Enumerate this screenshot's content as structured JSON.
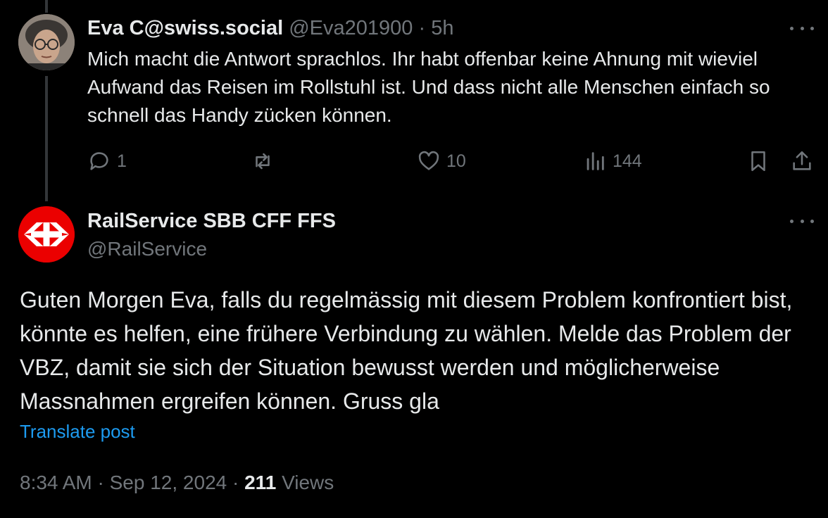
{
  "reply": {
    "author_name": "Eva C@swiss.social",
    "author_handle": "@Eva201900",
    "separator": "·",
    "time_ago": "5h",
    "text": "Mich macht die Antwort sprachlos. Ihr habt offenbar keine Ahnung mit wieviel Aufwand das Reisen im Rollstuhl ist. Und dass nicht alle Menschen einfach so schnell das Handy zücken können.",
    "reply_count": "1",
    "repost_count": "",
    "like_count": "10",
    "view_count": "144"
  },
  "main_post": {
    "author_name": "RailService SBB CFF FFS",
    "author_handle": "@RailService",
    "text": "Guten Morgen Eva, falls du regelmässig mit diesem Problem konfrontiert bist, könnte es helfen, eine frühere Verbindung zu wählen. Melde das Problem der VBZ, damit sie sich der Situation bewusst werden und möglicherweise Massnahmen ergreifen können. Gruss gla",
    "translate_label": "Translate post",
    "time": "8:34 AM",
    "date": "Sep 12, 2024",
    "separator": "·",
    "views_count": "211",
    "views_label": "Views"
  },
  "colors": {
    "background": "#000000",
    "text": "#e7e9ea",
    "muted": "#71767b",
    "link": "#1d9bf0",
    "sbb_red": "#eb0000"
  },
  "icons": [
    "reply-icon",
    "repost-icon",
    "like-icon",
    "views-icon",
    "bookmark-icon",
    "share-icon",
    "more-icon",
    "sbb-logo"
  ]
}
